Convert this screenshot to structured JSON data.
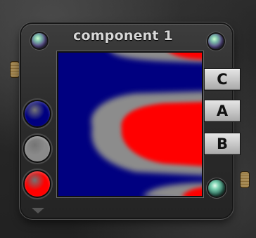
{
  "panel": {
    "title": "component 1"
  },
  "swatches": [
    {
      "name": "dark-blue",
      "color": "#000080"
    },
    {
      "name": "gray",
      "color": "#8a8a8a"
    },
    {
      "name": "red",
      "color": "#ff0000"
    }
  ],
  "tabs": [
    {
      "label": "C"
    },
    {
      "label": "A"
    },
    {
      "label": "B"
    }
  ],
  "colormap": {
    "low": "#000080",
    "mid": "#8c8c8c",
    "high": "#ff0000"
  }
}
